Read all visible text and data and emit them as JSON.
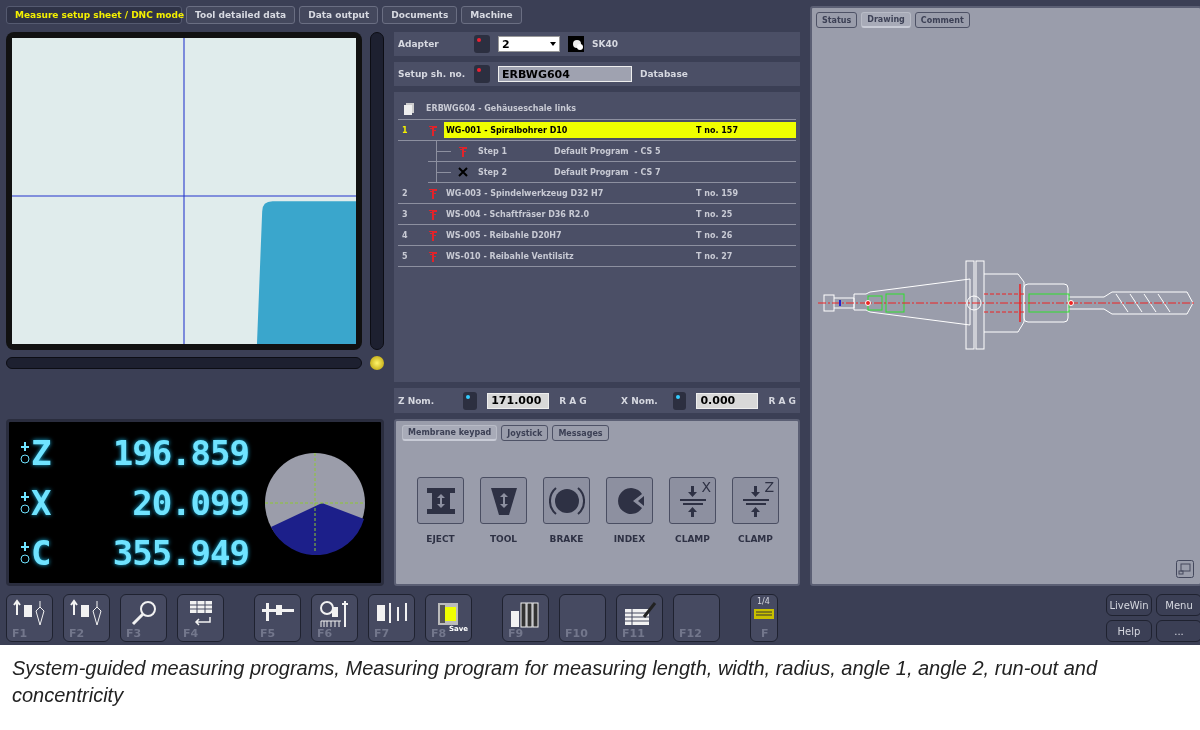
{
  "tabs": [
    {
      "label": "Measure setup sheet / DNC mode",
      "selected": true
    },
    {
      "label": "Tool detailed data",
      "selected": false
    },
    {
      "label": "Data output",
      "selected": false
    },
    {
      "label": "Documents",
      "selected": false
    },
    {
      "label": "Machine",
      "selected": false
    }
  ],
  "adapter": {
    "label": "Adapter",
    "value": "2",
    "holder": "SK40"
  },
  "setup": {
    "label": "Setup sh. no.",
    "value": "ERBWG604",
    "source": "Database"
  },
  "program": {
    "title": "ERBWG604 - Gehäuseschale links",
    "items": [
      {
        "number": "1",
        "name": "WG-001 - Spiralbohrer D10",
        "tool_no": "T no. 157",
        "selected": true,
        "children": [
          {
            "name": "Step 1",
            "program": "Default Program  - CS 5",
            "kind": "tool"
          },
          {
            "name": "Step 2",
            "program": "Default Program  - CS 7",
            "kind": "cross"
          }
        ]
      },
      {
        "number": "2",
        "name": "WG-003 - Spindelwerkzeug D32 H7",
        "tool_no": "T no. 159",
        "selected": false
      },
      {
        "number": "3",
        "name": "WS-004 - Schaftfräser D36 R2.0",
        "tool_no": "T no. 25",
        "selected": false
      },
      {
        "number": "4",
        "name": "WS-005 - Reibahle D20H7",
        "tool_no": "T no. 26",
        "selected": false
      },
      {
        "number": "5",
        "name": "WS-010 - Reibahle Ventilsitz",
        "tool_no": "T no. 27",
        "selected": false
      }
    ]
  },
  "nominal": [
    {
      "label": "Z Nom.",
      "value": "171.000",
      "suffix": "R A G"
    },
    {
      "label": "X Nom.",
      "value": "0.000",
      "suffix": "R A G"
    }
  ],
  "dro": [
    {
      "axis": "Z",
      "value": "196.859"
    },
    {
      "axis": "X",
      "value": "20.099"
    },
    {
      "axis": "C",
      "value": "355.949"
    }
  ],
  "keypad": {
    "tabs": [
      {
        "label": "Membrane keypad",
        "selected": true
      },
      {
        "label": "Joystick",
        "selected": false
      },
      {
        "label": "Messages",
        "selected": false
      }
    ],
    "keys": [
      {
        "label": "EJECT",
        "kind": "eject"
      },
      {
        "label": "TOOL",
        "kind": "tool"
      },
      {
        "label": "BRAKE",
        "kind": "brake"
      },
      {
        "label": "INDEX",
        "kind": "index"
      },
      {
        "label": "CLAMP",
        "kind": "clamp",
        "axis": "X"
      },
      {
        "label": "CLAMP",
        "kind": "clamp",
        "axis": "Z"
      }
    ]
  },
  "fkey_groups": [
    [
      {
        "label": "F1",
        "kind": "load"
      },
      {
        "label": "F2",
        "kind": "unload"
      },
      {
        "label": "F3",
        "kind": "magnifier"
      },
      {
        "label": "F4",
        "kind": "table"
      }
    ],
    [
      {
        "label": "F5",
        "kind": "caliper"
      },
      {
        "label": "F6",
        "kind": "measure"
      },
      {
        "label": "F7",
        "kind": "tools"
      },
      {
        "label": "F8",
        "kind": "safe",
        "caption": "Save"
      }
    ],
    [
      {
        "label": "F9",
        "kind": "binders"
      },
      {
        "label": "F10",
        "kind": "empty"
      },
      {
        "label": "F11",
        "kind": "edit"
      },
      {
        "label": "F12",
        "kind": "empty"
      }
    ],
    [
      {
        "label": "F",
        "kind": "keyboard",
        "page": "1/4"
      }
    ]
  ],
  "side_tabs": [
    {
      "label": "Status",
      "selected": false
    },
    {
      "label": "Drawing",
      "selected": true
    },
    {
      "label": "Comment",
      "selected": false
    }
  ],
  "side_buttons": [
    "LiveWin",
    "Menu",
    "Help",
    "..."
  ],
  "caption": "System-guided measuring programs, Measuring program for measuring length, width, radius, angle 1, angle 2, run-out and concentricity"
}
